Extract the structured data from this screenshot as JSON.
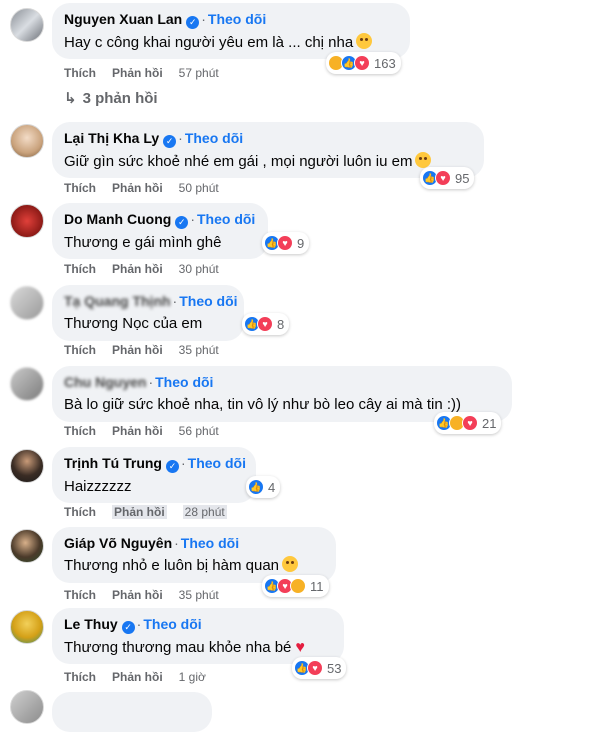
{
  "ui": {
    "follow_label": "Theo dõi",
    "like_label": "Thích",
    "reply_label": "Phản hồi"
  },
  "comments": [
    {
      "name": "Nguyen Xuan Lan",
      "text": "Hay c công khai người yêu em là ... chị nha",
      "time": "57 phút",
      "reactions": "163"
    },
    {
      "name": "Lại Thị Kha Ly",
      "text": "Giữ gìn sức khoẻ nhé em gái , mọi người luôn iu em",
      "time": "50 phút",
      "reactions": "95"
    },
    {
      "name": "Do Manh Cuong",
      "text": "Thương e gái mình ghê",
      "time": "30 phút",
      "reactions": "9"
    },
    {
      "name": "Tạ Quang Thịnh",
      "text": "Thương Nọc của em",
      "time": "35 phút",
      "reactions": "8"
    },
    {
      "name": "Chu Nguyen",
      "text": "Bà lo giữ sức khoẻ nha, tin vô lý như bò leo cây ai mà tin :))",
      "time": "56 phút",
      "reactions": "21"
    },
    {
      "name": "Trịnh Tú Trung",
      "text": "Haizzzzzz",
      "time": "28 phút",
      "reactions": "4"
    },
    {
      "name": "Giáp Võ Nguyên",
      "text": "Thương nhỏ e luôn bị hàm quan",
      "time": "35 phút",
      "reactions": "11"
    },
    {
      "name": "Le Thuy",
      "text": "Thương thương mau khỏe nha bé",
      "time": "1 giờ",
      "reactions": "53"
    }
  ],
  "replies_link": "3 phản hồi",
  "colors": {
    "link": "#1877f2",
    "bubble": "#f0f2f5",
    "meta": "#65676b"
  },
  "icons": [
    "verified-icon",
    "like-reaction-icon",
    "love-reaction-icon",
    "haha-reaction-icon",
    "reply-arrow-icon",
    "heart-emoji-icon",
    "smile-emoji-icon"
  ]
}
